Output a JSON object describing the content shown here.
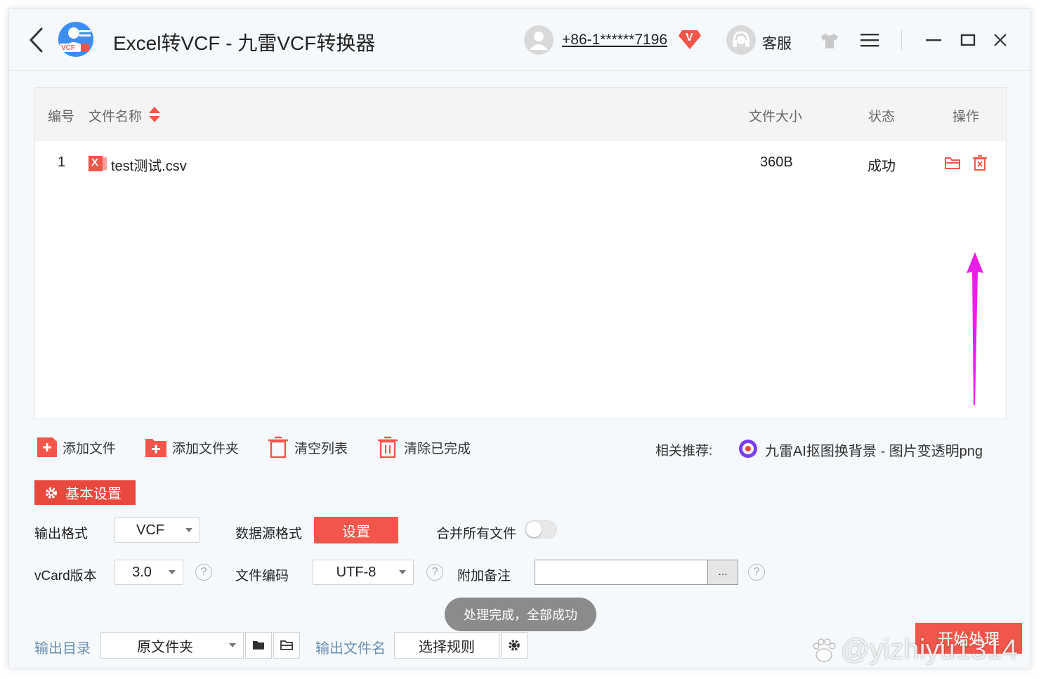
{
  "header": {
    "title": "Excel转VCF - 九雷VCF转换器",
    "logo_text": "VCF",
    "phone": "+86-1******7196",
    "vip_badge": "V",
    "customer_service": "客服"
  },
  "table": {
    "columns": {
      "index": "编号",
      "filename": "文件名称",
      "size": "文件大小",
      "status": "状态",
      "actions": "操作"
    },
    "rows": [
      {
        "index": "1",
        "file_badge": "X",
        "filename": "test测试.csv",
        "size": "360B",
        "status": "成功"
      }
    ]
  },
  "toolbar": {
    "add_file": "添加文件",
    "add_folder": "添加文件夹",
    "clear_list": "清空列表",
    "clear_done": "清除已完成",
    "recommend_label": "相关推荐:",
    "recommend_link": "九雷AI抠图换背景 - 图片变透明png"
  },
  "settings": {
    "tab_label": "基本设置",
    "output_format_label": "输出格式",
    "output_format_value": "VCF",
    "source_format_label": "数据源格式",
    "source_format_button": "设置",
    "merge_label": "合并所有文件",
    "merge_on": false,
    "vcard_label": "vCard版本",
    "vcard_value": "3.0",
    "encoding_label": "文件编码",
    "encoding_value": "UTF-8",
    "note_label": "附加备注",
    "note_value": "",
    "note_button": "...",
    "help_glyph": "?"
  },
  "toast": "处理完成，全部成功",
  "bottom": {
    "output_dir_label": "输出目录",
    "output_dir_value": "原文件夹",
    "output_name_label": "输出文件名",
    "output_name_button": "选择规则",
    "start_button": "开始处理"
  },
  "watermark": "@yizhiyu1314",
  "colors": {
    "accent_red": "#f2564a",
    "tab_red": "#e9483d",
    "arrow_magenta": "#e91ee9",
    "label_blue": "#6b8fb1"
  }
}
